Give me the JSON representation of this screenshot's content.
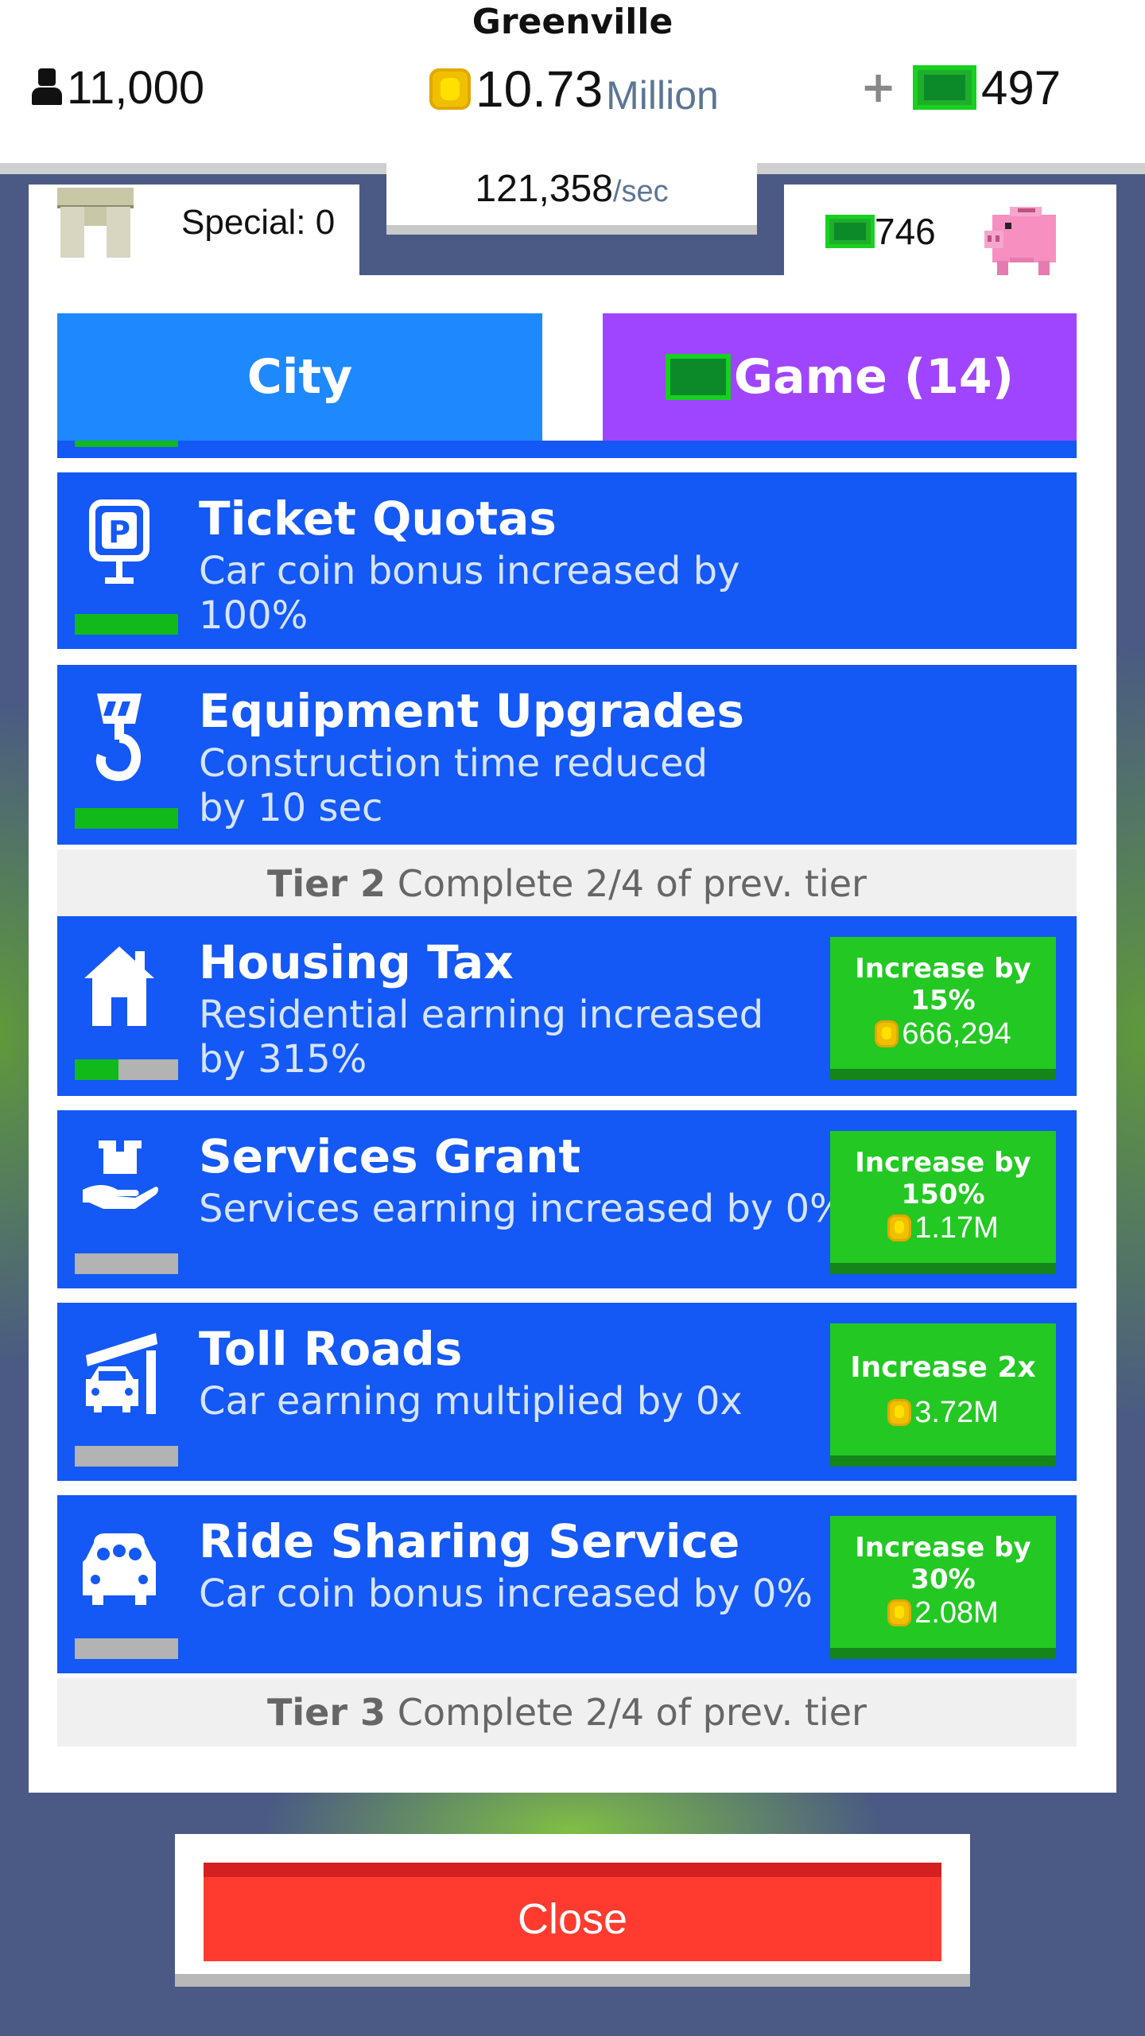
{
  "header": {
    "city_name": "Greenville",
    "population": "11,000",
    "coins_value": "10.73",
    "coins_unit": "Million",
    "plus": "+",
    "cash": "497",
    "rate_value": "121,358",
    "rate_unit": "/sec"
  },
  "subheader": {
    "special_label": "Special: 0",
    "bank_cash": "746"
  },
  "tabs": {
    "city_label": "City",
    "game_label": "Game (14)"
  },
  "upgrades": [
    {
      "title": "Ticket Quotas",
      "desc": "Car coin bonus increased by 100%",
      "icon": "parking-sign-icon",
      "progress": 1.0
    },
    {
      "title": "Equipment Upgrades",
      "desc": "Construction time reduced by 10 sec",
      "icon": "crane-hook-icon",
      "progress": 1.0
    },
    {
      "title": "Housing Tax",
      "desc": "Residential earning increased by 315%",
      "icon": "house-icon",
      "progress": 0.42,
      "button_label": "Increase by 15%",
      "button_price": "666,294"
    },
    {
      "title": "Services Grant",
      "desc": "Services earning increased by 0%",
      "icon": "hand-box-icon",
      "progress": 0.0,
      "button_label": "Increase by 150%",
      "button_price": "1.17M"
    },
    {
      "title": "Toll Roads",
      "desc": "Car earning multiplied by 0x",
      "icon": "toll-car-icon",
      "progress": 0.0,
      "button_label": "Increase 2x",
      "button_price": "3.72M"
    },
    {
      "title": "Ride Sharing Service",
      "desc": "Car coin bonus increased by 0%",
      "icon": "carpool-icon",
      "progress": 0.0,
      "button_label": "Increase by 30%",
      "button_price": "2.08M"
    }
  ],
  "tiers": [
    {
      "label": "Tier 2",
      "text": "Complete 2/4 of prev. tier"
    },
    {
      "label": "Tier 3",
      "text": "Complete 2/4 of prev. tier"
    }
  ],
  "close_label": "Close",
  "colors": {
    "row_blue": "#1458f5",
    "buy_green": "#23c823",
    "tab_city": "#1e88ff",
    "tab_game": "#a045ff",
    "close_red": "#ff3b2f"
  }
}
